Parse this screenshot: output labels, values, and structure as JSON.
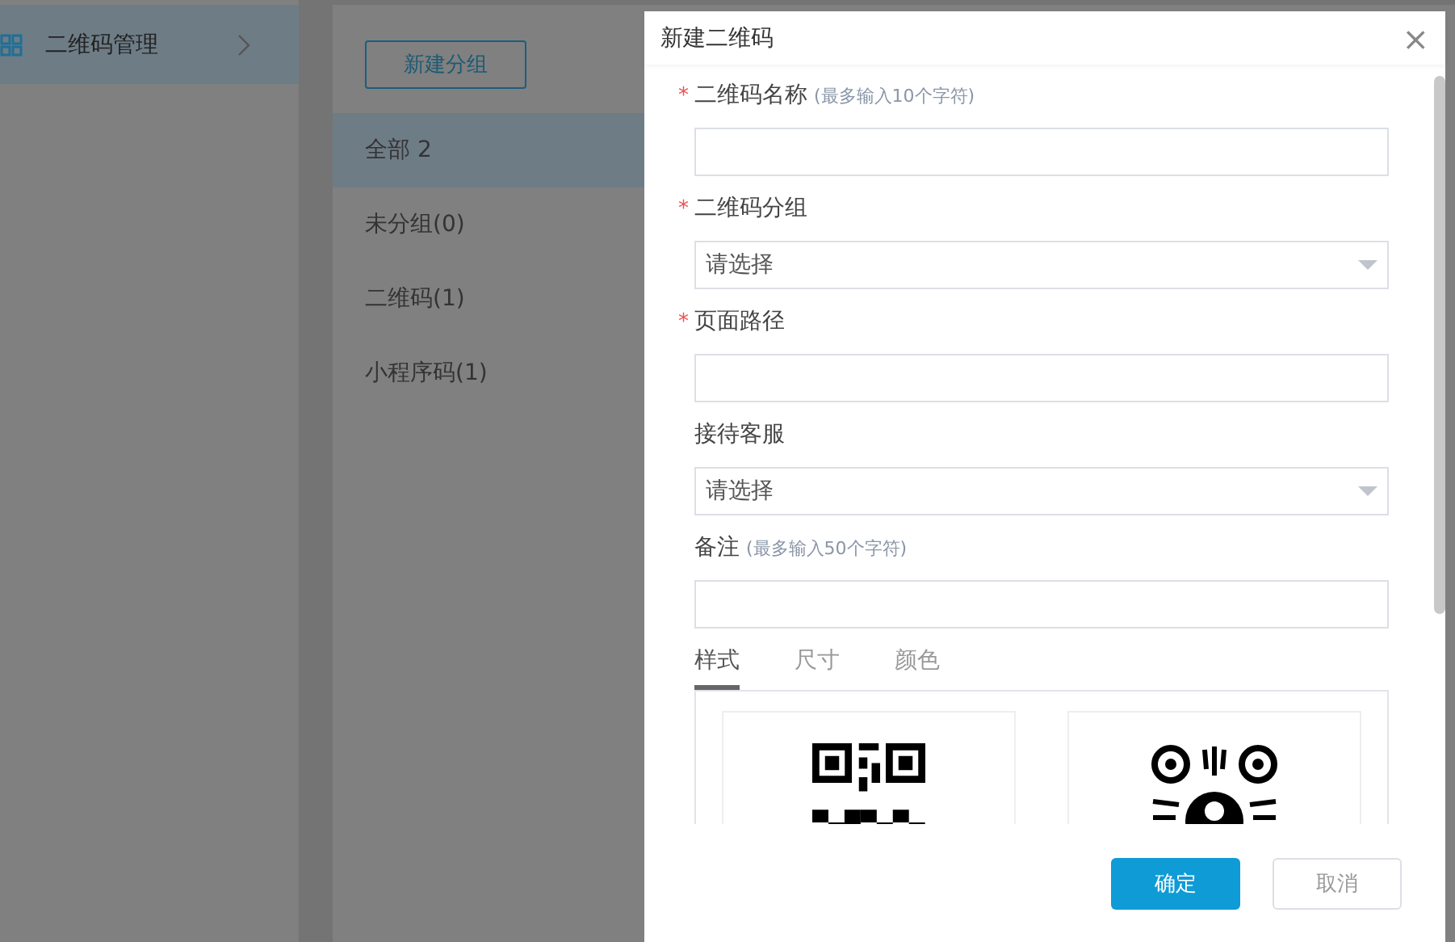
{
  "sidebar": {
    "items": [
      {
        "label": "二维码管理",
        "selected": true
      }
    ]
  },
  "groups": {
    "new_button": "新建分组",
    "items": [
      {
        "label": "全部 2",
        "selected": true
      },
      {
        "label": "未分组(0)",
        "selected": false
      },
      {
        "label": "二维码(1)",
        "selected": false
      },
      {
        "label": "小程序码(1)",
        "selected": false
      }
    ]
  },
  "dialog": {
    "title": "新建二维码",
    "close": "×",
    "fields": [
      {
        "kind": "input",
        "required_mark": "*",
        "label": "二维码名称",
        "hint": "(最多输入10个字符)"
      },
      {
        "kind": "select",
        "required_mark": "*",
        "label": "二维码分组",
        "placeholder": "请选择"
      },
      {
        "kind": "input",
        "required_mark": "*",
        "label": "页面路径"
      },
      {
        "kind": "select",
        "label": "接待客服",
        "placeholder": "请选择"
      },
      {
        "kind": "input",
        "label": "备注",
        "hint": "(最多输入50个字符)"
      }
    ],
    "tabs": [
      {
        "label": "样式",
        "selected": true
      },
      {
        "label": "尺寸",
        "selected": false
      },
      {
        "label": "颜色",
        "selected": false
      }
    ],
    "styles": [
      {
        "kind": "square"
      },
      {
        "kind": "round"
      }
    ],
    "buttons": [
      {
        "label": "确定",
        "kind": "primary"
      },
      {
        "label": "取消",
        "kind": "default"
      }
    ]
  }
}
